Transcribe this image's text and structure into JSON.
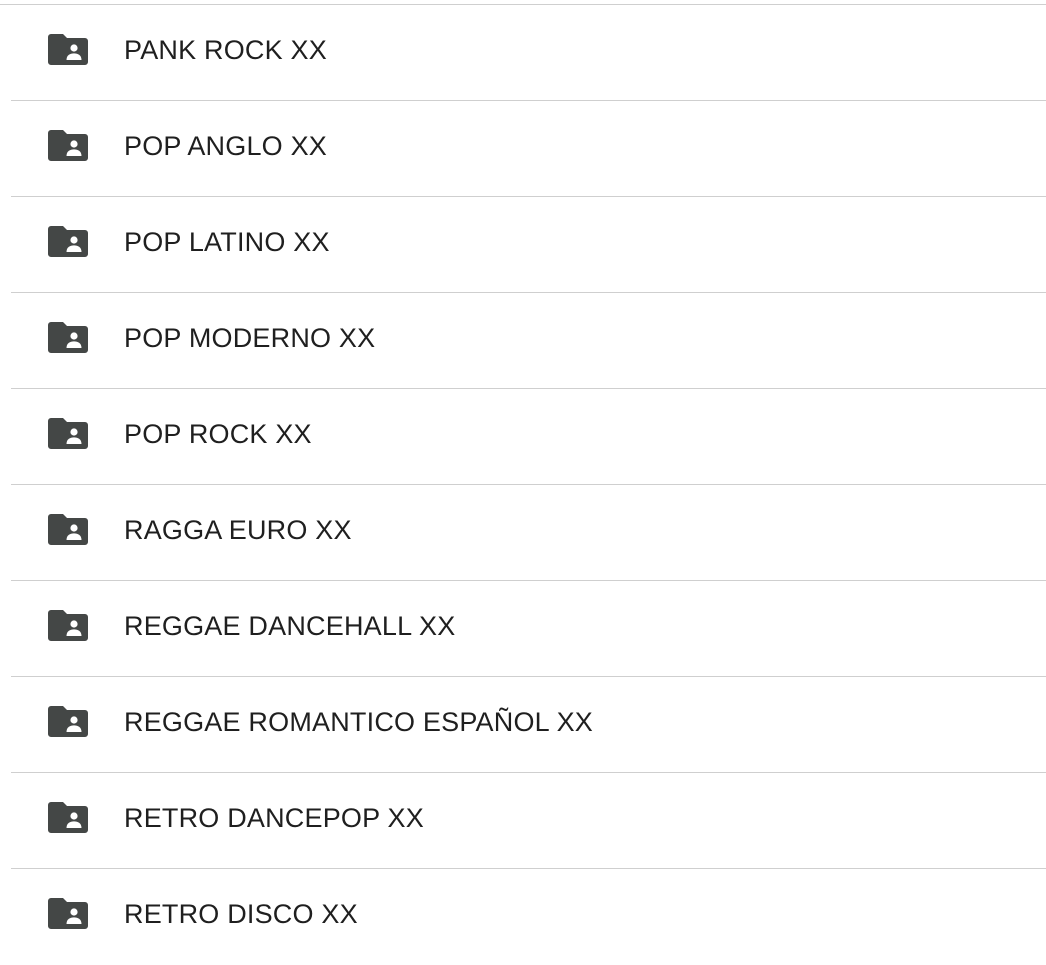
{
  "folders": [
    {
      "name": "PANK ROCK XX",
      "icon": "shared-folder-icon"
    },
    {
      "name": "POP ANGLO XX",
      "icon": "shared-folder-icon"
    },
    {
      "name": "POP LATINO XX",
      "icon": "shared-folder-icon"
    },
    {
      "name": "POP MODERNO XX",
      "icon": "shared-folder-icon"
    },
    {
      "name": "POP ROCK XX",
      "icon": "shared-folder-icon"
    },
    {
      "name": "RAGGA EURO XX",
      "icon": "shared-folder-icon"
    },
    {
      "name": "REGGAE DANCEHALL XX",
      "icon": "shared-folder-icon"
    },
    {
      "name": "REGGAE ROMANTICO ESPAÑOL XX",
      "icon": "shared-folder-icon"
    },
    {
      "name": "RETRO DANCEPOP XX",
      "icon": "shared-folder-icon"
    },
    {
      "name": "RETRO DISCO XX",
      "icon": "shared-folder-icon"
    }
  ],
  "colors": {
    "icon": "#444746",
    "text": "#1f1f1f",
    "divider": "#cfcfcf",
    "background": "#ffffff"
  }
}
